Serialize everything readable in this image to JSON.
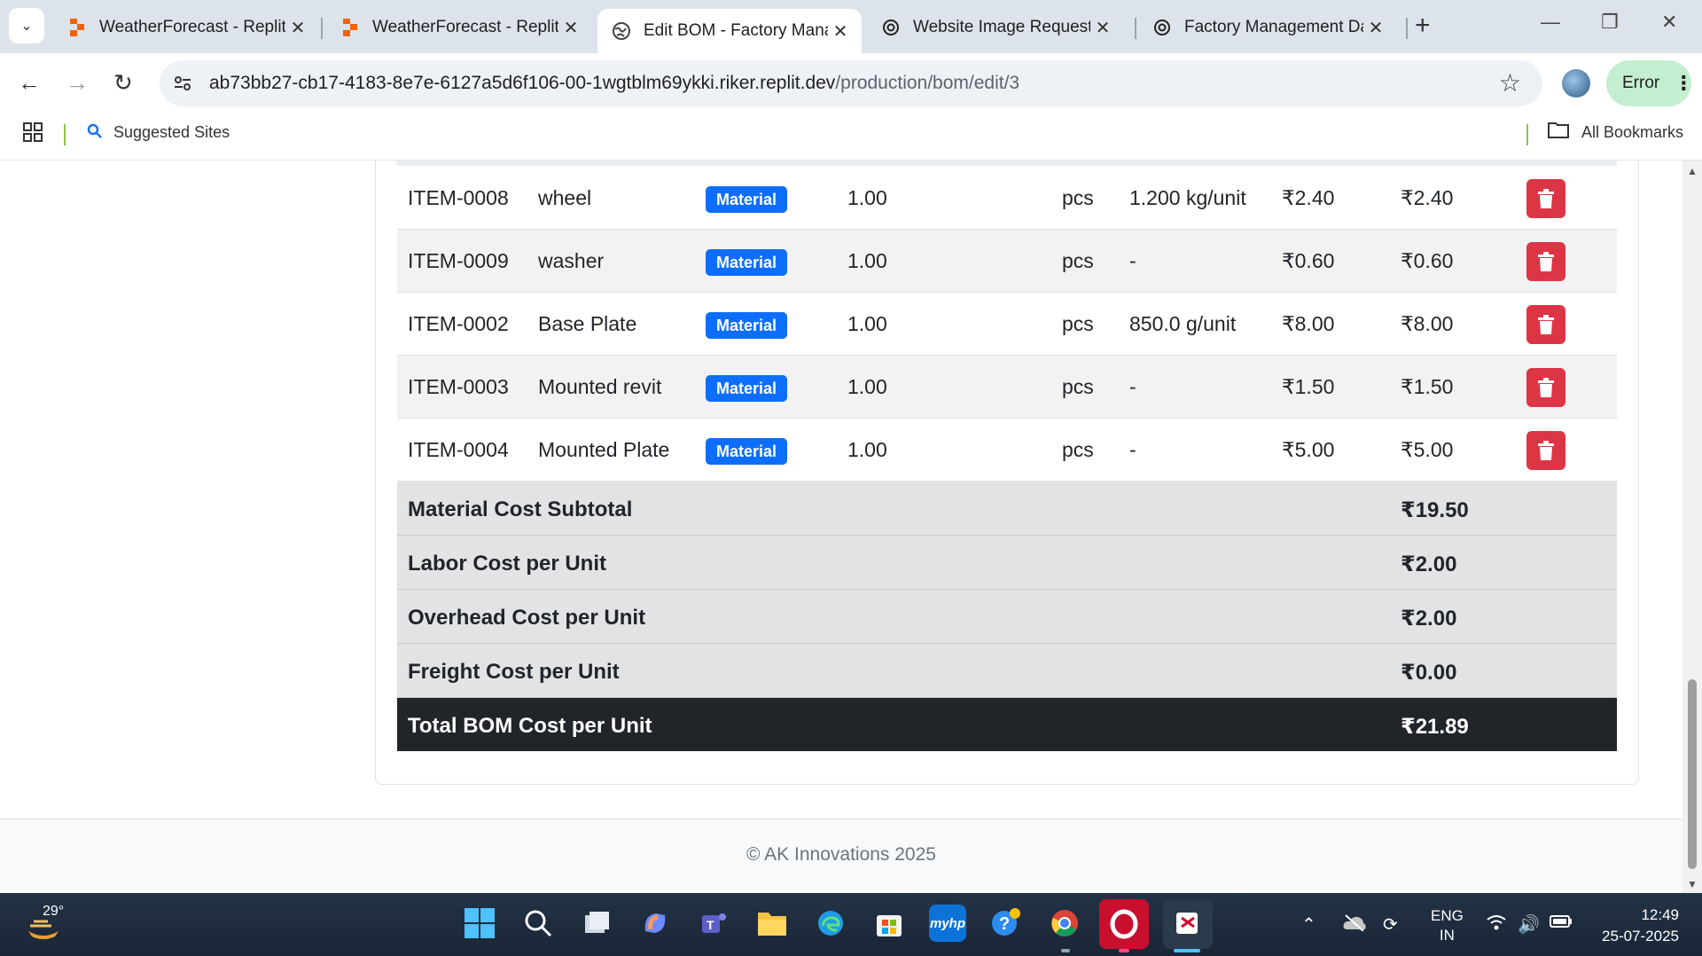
{
  "browser": {
    "tabs": [
      {
        "title": "WeatherForecast - Replit",
        "icon": "replit-icon"
      },
      {
        "title": "WeatherForecast - Replit",
        "icon": "replit-icon"
      },
      {
        "title": "Edit BOM - Factory Mana",
        "icon": "globe-icon",
        "active": true
      },
      {
        "title": "Website Image Request",
        "icon": "chatgpt-icon"
      },
      {
        "title": "Factory Management Dat",
        "icon": "chatgpt-icon"
      }
    ],
    "url_host": "ab73bb27-cb17-4183-8e7e-6127a5d6f106-00-1wgtblm69ykki.riker.replit.dev",
    "url_path": "/production/bom/edit/3",
    "profile_status": "Error",
    "bookmarks": {
      "suggested": "Suggested Sites",
      "all": "All Bookmarks"
    }
  },
  "bom_items": [
    {
      "code": "ITEM-0008",
      "name": "wheel",
      "type": "Material",
      "qty": "1.00",
      "unit": "pcs",
      "weight": "1.200 kg/unit",
      "rate": "₹2.40",
      "amount": "₹2.40"
    },
    {
      "code": "ITEM-0009",
      "name": "washer",
      "type": "Material",
      "qty": "1.00",
      "unit": "pcs",
      "weight": "-",
      "rate": "₹0.60",
      "amount": "₹0.60"
    },
    {
      "code": "ITEM-0002",
      "name": "Base Plate",
      "type": "Material",
      "qty": "1.00",
      "unit": "pcs",
      "weight": "850.0 g/unit",
      "rate": "₹8.00",
      "amount": "₹8.00"
    },
    {
      "code": "ITEM-0003",
      "name": "Mounted revit",
      "type": "Material",
      "qty": "1.00",
      "unit": "pcs",
      "weight": "-",
      "rate": "₹1.50",
      "amount": "₹1.50"
    },
    {
      "code": "ITEM-0004",
      "name": "Mounted Plate",
      "type": "Material",
      "qty": "1.00",
      "unit": "pcs",
      "weight": "-",
      "rate": "₹5.00",
      "amount": "₹5.00"
    }
  ],
  "summary": [
    {
      "label": "Material Cost Subtotal",
      "value": "₹19.50"
    },
    {
      "label": "Labor Cost per Unit",
      "value": "₹2.00"
    },
    {
      "label": "Overhead Cost per Unit",
      "value": "₹2.00"
    },
    {
      "label": "Freight Cost per Unit",
      "value": "₹0.00"
    }
  ],
  "total": {
    "label": "Total BOM Cost per Unit",
    "value": "₹21.89"
  },
  "footer": "© AK Innovations 2025",
  "taskbar": {
    "temperature": "29°",
    "lang_line1": "ENG",
    "lang_line2": "IN",
    "time": "12:49",
    "date": "25-07-2025"
  },
  "colors": {
    "badge": "#0d6efd",
    "delete": "#dc3545",
    "total_bg": "#212529",
    "summary_bg": "#e2e3e5"
  }
}
